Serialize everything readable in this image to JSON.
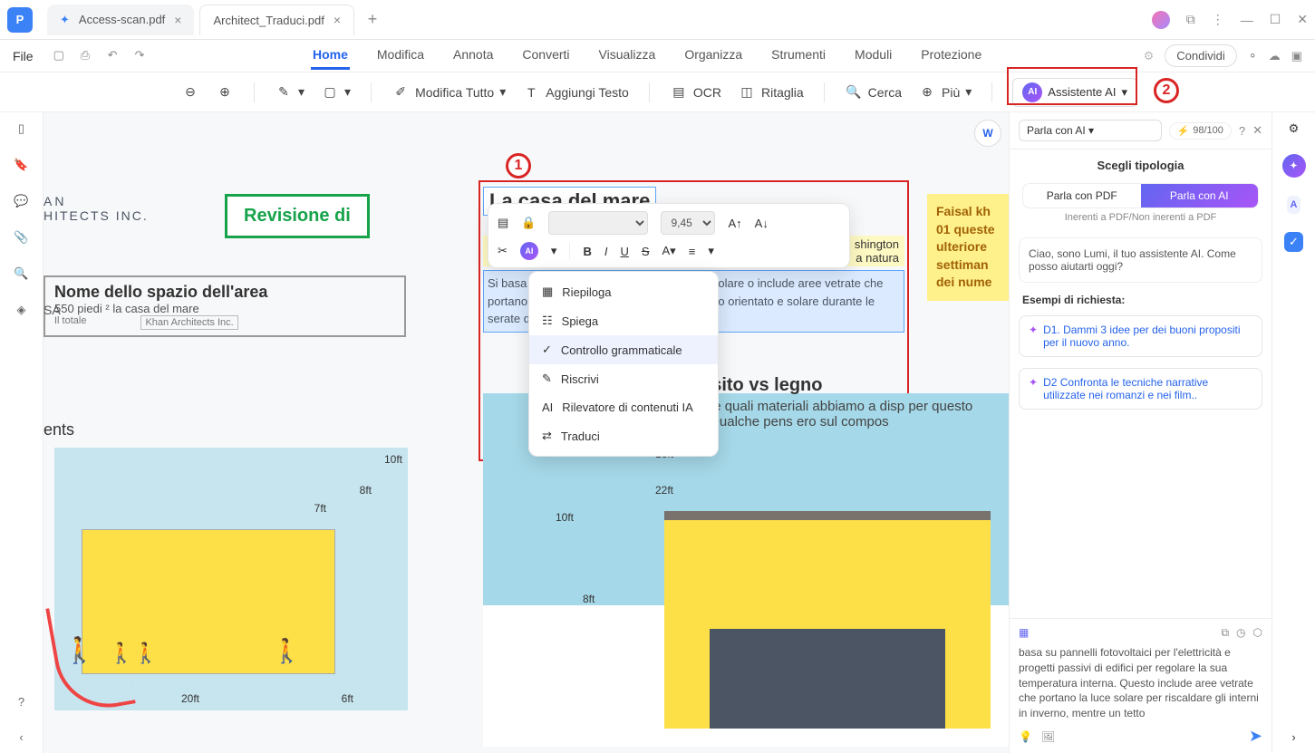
{
  "app": {
    "logo_letter": "P"
  },
  "tabs": {
    "inactive": "Access-scan.pdf",
    "active": "Architect_Traduci.pdf"
  },
  "menubar": {
    "file": "File",
    "items": [
      "Home",
      "Modifica",
      "Annota",
      "Converti",
      "Visualizza",
      "Organizza",
      "Strumenti",
      "Moduli",
      "Protezione"
    ],
    "share": "Condividi"
  },
  "ribbon": {
    "edit_all": "Modifica Tutto",
    "add_text": "Aggiungi Testo",
    "ocr": "OCR",
    "crop": "Ritaglia",
    "search": "Cerca",
    "more": "Più",
    "ai": "Assistente AI"
  },
  "callouts": {
    "one": "1",
    "two": "2"
  },
  "doc": {
    "revision": "Revisione di",
    "area_name": "Nome dello spazio dell'area",
    "area_sub_1": "550 piedi ² la casa del mare",
    "area_sub_2": "Il totale",
    "area_sub_3": "Khan Architects Inc.",
    "left_frag_1": "AN",
    "left_frag_2": "HITECTS INC.",
    "left_frag_3": "SA",
    "left_frag_4": "ents",
    "title_sea": "La casa del mare",
    "para_frag_1": "shington",
    "para_frag_2": "a natura",
    "para": "Si basa                                                               tà e progetti passivi di edifici per regolare                                                           o include aree vetrate che portano la luce s                                                          erno, mentre un tetto esteso orientato                                                          e solare durante le serate d'estate.",
    "sticky_1": "Faisal kh",
    "sticky_2": "01 queste",
    "sticky_3": "ulteriore",
    "sticky_4": "settiman",
    "sticky_5": "dei nume",
    "composite_title": "osito vs legno",
    "composite_text": "o esaminare quali materiali abbiamo a disp  per questo pannello? Qualche pens   ero sul compos",
    "dims": {
      "d10a": "10ft",
      "d8": "8ft",
      "d7": "7ft",
      "d20": "20ft",
      "d6": "6ft",
      "d16": "16ft",
      "d22": "22ft",
      "d10b": "10ft",
      "d8b": "8ft"
    }
  },
  "edit_toolbar": {
    "font_size": "9,45"
  },
  "ai_menu": {
    "summarize": "Riepiloga",
    "explain": "Spiega",
    "grammar": "Controllo grammaticale",
    "rewrite": "Riscrivi",
    "detector": "Rilevatore di contenuti IA",
    "translate": "Traduci"
  },
  "panel": {
    "mode": "Parla con AI",
    "usage": "98/100",
    "heading": "Scegli tipologia",
    "pill_pdf": "Parla con PDF",
    "pill_ai": "Parla con AI",
    "hint": "Inerenti a PDF/Non inerenti a PDF",
    "greeting": "Ciao, sono Lumi, il tuo assistente AI. Come posso aiutarti oggi?",
    "examples_label": "Esempi di richiesta:",
    "ex1": "D1. Dammi 3 idee per dei buoni propositi per il nuovo anno.",
    "ex2": "D2 Confronta le tecniche narrative utilizzate nei romanzi e nei film..",
    "footer_text": "basa su pannelli fotovoltaici per l'elettricità e progetti passivi di edifici per regolare la sua temperatura interna. Questo include aree vetrate che portano la luce solare per riscaldare gli interni in inverno, mentre un tetto"
  }
}
